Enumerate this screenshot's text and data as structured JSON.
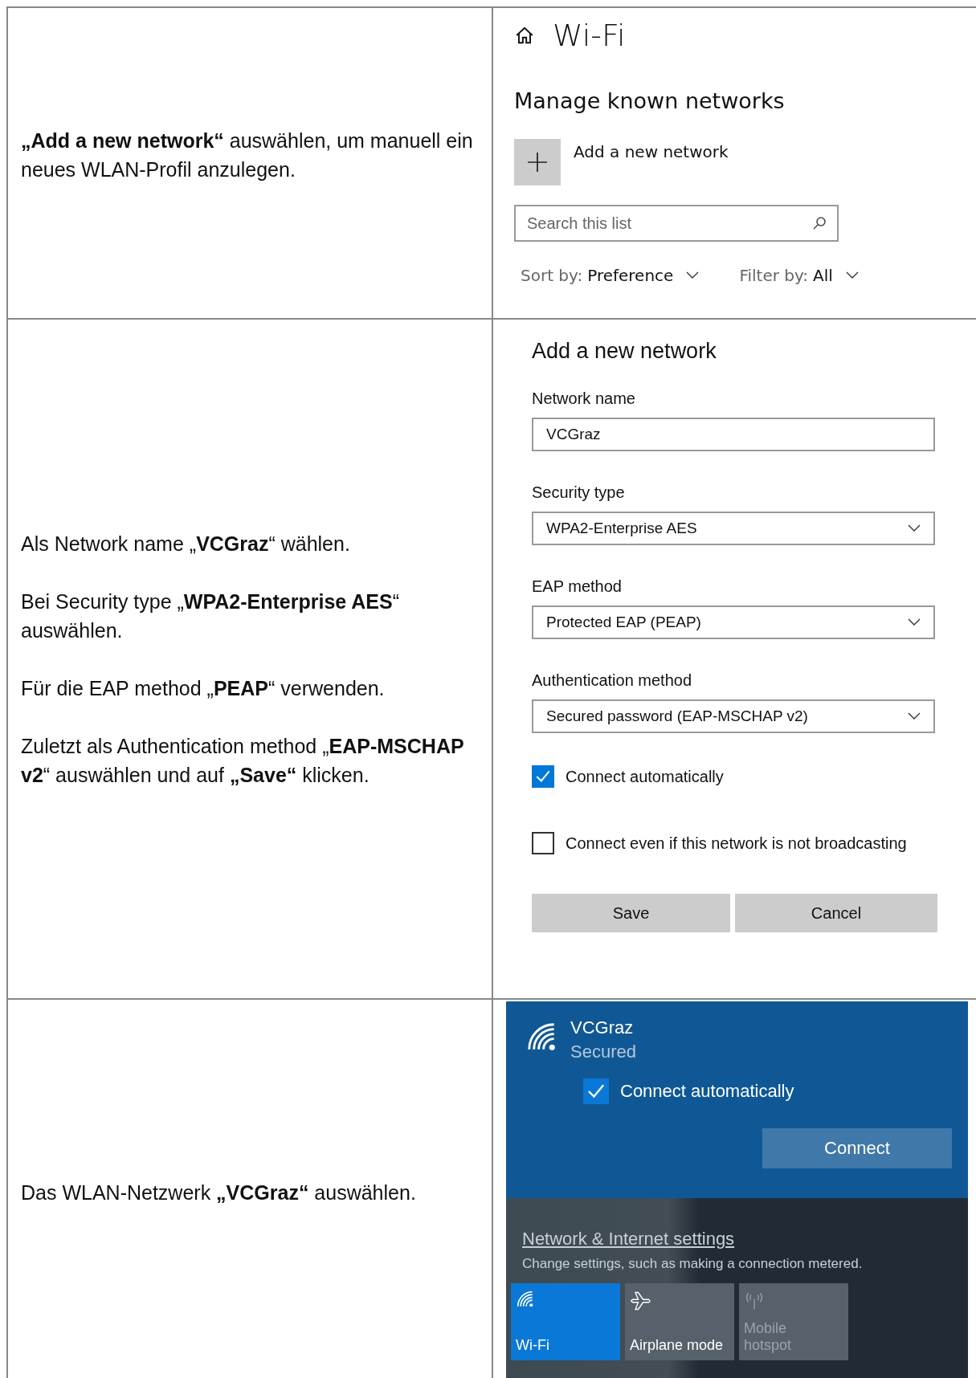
{
  "rows": [
    {
      "instructions": [
        "**„Add a new network“** auswählen, um manuell ein neues WLAN-Profil anzulegen."
      ],
      "panel": {
        "kind": "known_networks",
        "title": "Wi-Fi",
        "heading": "Manage known networks",
        "add_label": "Add a new network",
        "search": {
          "placeholder": "Search this list"
        },
        "sort": {
          "label": "Sort by:",
          "value": "Preference"
        },
        "filter": {
          "label": "Filter by:",
          "value": "All"
        }
      }
    },
    {
      "instructions": [
        "Als Network name „**VCGraz**“ wählen.",
        "Bei Security type „**WPA2-Enterprise AES**“ auswählen.",
        "Für die EAP method „**PEAP**“ verwenden.",
        "Zuletzt als Authentication method „**EAP-MSCHAP v2**“ auswählen und auf **„Save“** klicken."
      ],
      "panel": {
        "kind": "add_network",
        "title": "Add a new network",
        "fields": [
          {
            "kind": "text",
            "label": "Network name",
            "value": "VCGraz"
          },
          {
            "kind": "select",
            "label": "Security type",
            "value": "WPA2-Enterprise AES"
          },
          {
            "kind": "select",
            "label": "EAP method",
            "value": "Protected EAP (PEAP)"
          },
          {
            "kind": "select",
            "label": "Authentication method",
            "value": "Secured password (EAP-MSCHAP v2)"
          }
        ],
        "checkboxes": [
          {
            "label": "Connect automatically",
            "checked": true
          },
          {
            "label": "Connect even if this network is not broadcasting",
            "checked": false
          }
        ],
        "buttons": [
          "Save",
          "Cancel"
        ]
      }
    },
    {
      "instructions": [
        "Das WLAN-Netzwerk **„VCGraz“** auswählen."
      ],
      "panel": {
        "kind": "flyout",
        "network": "VCGraz",
        "status": "Secured",
        "auto_connect": {
          "label": "Connect automatically",
          "checked": true
        },
        "connect_button": "Connect",
        "settings_link": "Network & Internet settings",
        "settings_hint": "Change settings, such as making a connection metered.",
        "tiles": [
          {
            "kind": "wifi",
            "label": "Wi-Fi",
            "on": true,
            "disabled": false
          },
          {
            "kind": "airplane",
            "label": "Airplane mode",
            "on": false,
            "disabled": false
          },
          {
            "kind": "hotspot",
            "label": "Mobile hotspot",
            "on": false,
            "disabled": true
          }
        ]
      }
    }
  ]
}
